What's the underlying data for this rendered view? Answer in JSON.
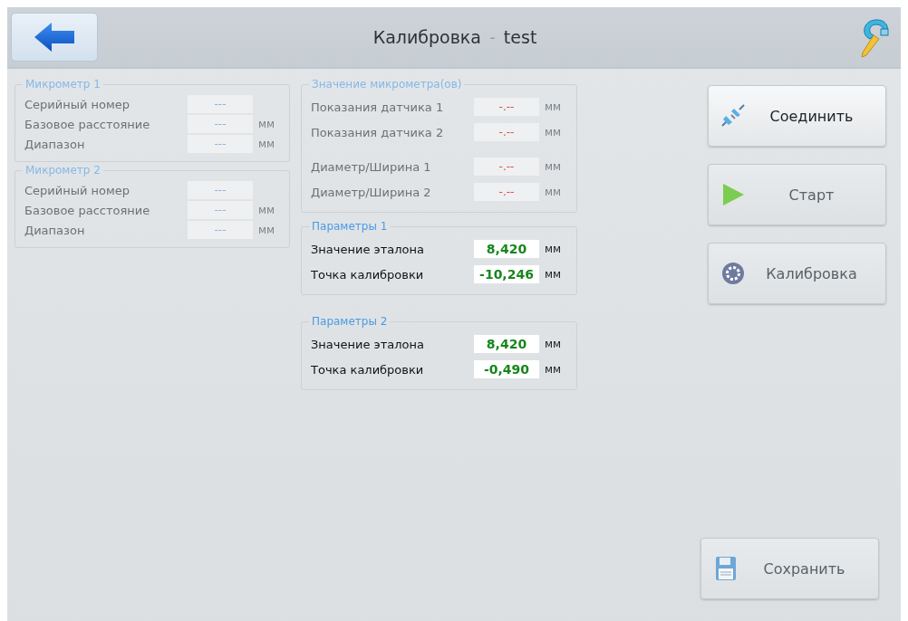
{
  "header": {
    "title": "Калибровка",
    "separator": "-",
    "subtitle": "test"
  },
  "left_groups": [
    {
      "title": "Микрометр 1",
      "disabled": true,
      "rows": [
        {
          "label": "Серийный номер",
          "value": "---",
          "kind": "empty"
        },
        {
          "label": "Базовое расстояние",
          "value": "---",
          "kind": "empty",
          "unit": "мм"
        },
        {
          "label": "Диапазон",
          "value": "---",
          "kind": "empty",
          "unit": "мм"
        }
      ]
    },
    {
      "title": "Микрометр 2",
      "disabled": true,
      "rows": [
        {
          "label": "Серийный номер",
          "value": "---",
          "kind": "empty"
        },
        {
          "label": "Базовое расстояние",
          "value": "---",
          "kind": "empty",
          "unit": "мм"
        },
        {
          "label": "Диапазон",
          "value": "---",
          "kind": "empty",
          "unit": "мм"
        }
      ]
    }
  ],
  "middle_groups": [
    {
      "title": "Значение микрометра(ов)",
      "disabled": true,
      "rows": [
        {
          "label": "Показания датчика 1",
          "value": "-.--",
          "kind": "error",
          "unit": "мм"
        },
        {
          "label": "Показания датчика 2",
          "value": "-.--",
          "kind": "error",
          "unit": "мм"
        },
        {
          "label": "Диаметр/Ширина 1",
          "value": "-.--",
          "kind": "error",
          "unit": "мм"
        },
        {
          "label": "Диаметр/Ширина 2",
          "value": "-.--",
          "kind": "error",
          "unit": "мм"
        }
      ]
    },
    {
      "title": "Параметры 1",
      "disabled": false,
      "rows": [
        {
          "label": "Значение эталона",
          "value": "8,420",
          "kind": "ok",
          "unit": "мм"
        },
        {
          "label": "Точка калибровки",
          "value": "-10,246",
          "kind": "ok",
          "unit": "мм"
        }
      ]
    },
    {
      "title": "Параметры 2",
      "disabled": false,
      "rows": [
        {
          "label": "Значение эталона",
          "value": "8,420",
          "kind": "ok",
          "unit": "мм"
        },
        {
          "label": "Точка калибровки",
          "value": "-0,490",
          "kind": "ok",
          "unit": "мм"
        }
      ]
    }
  ],
  "actions": [
    {
      "label": "Соединить",
      "disabled": false
    },
    {
      "label": "Старт",
      "disabled": true
    },
    {
      "label": "Калибровка",
      "disabled": true
    }
  ],
  "save_button": {
    "label": "Сохранить",
    "disabled": true
  }
}
